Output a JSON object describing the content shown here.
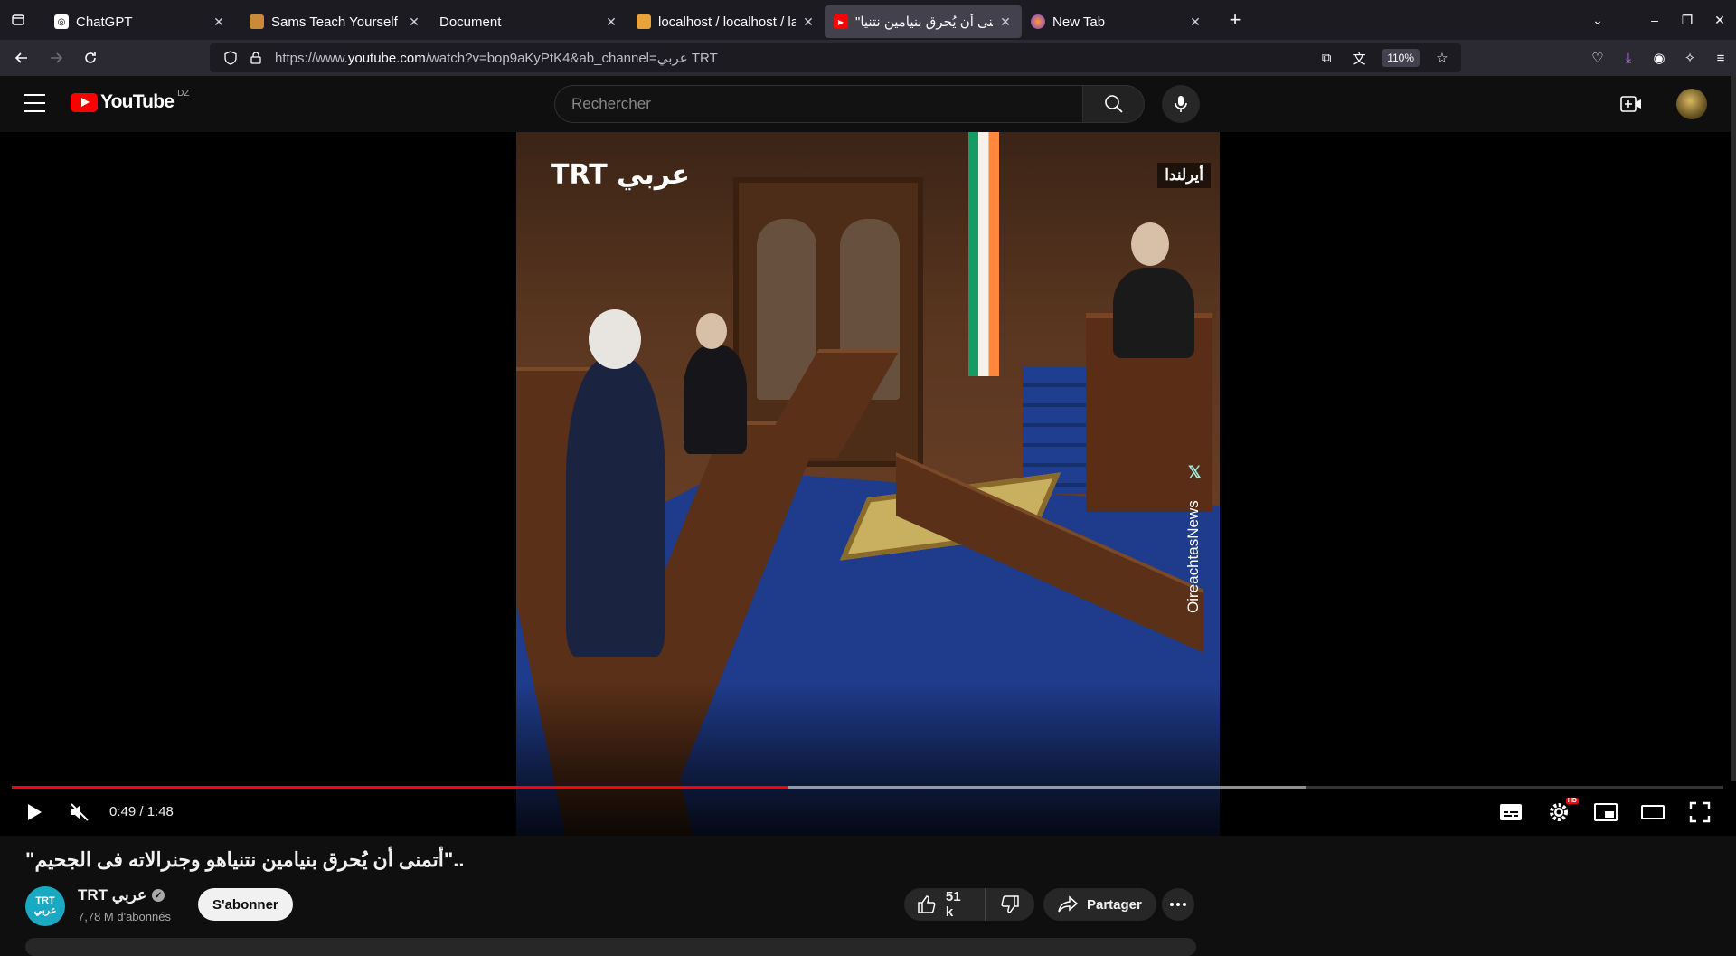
{
  "browser": {
    "tabs": [
      {
        "title": "ChatGPT",
        "active": false
      },
      {
        "title": "Sams Teach Yourself UML",
        "active": false
      },
      {
        "title": "Document",
        "active": false
      },
      {
        "title": "localhost / localhost / lara",
        "active": false
      },
      {
        "title": "\"أتمنى أن يُحرق بنيامين نتنيا",
        "active": true
      },
      {
        "title": "New Tab",
        "active": false
      }
    ],
    "url_prefix": "https://www.",
    "url_domain": "youtube.com",
    "url_rest": "/watch?v=bop9aKyPtK4&ab_channel=عربي TRT",
    "zoom": "110%"
  },
  "youtube": {
    "logo_text": "YouTube",
    "country_code": "DZ",
    "search_placeholder": "Rechercher"
  },
  "video": {
    "overlay_logo": "TRT عربي",
    "overlay_country": "أيرلندا",
    "watermark": "OireachtasNews",
    "current_time": "0:49",
    "duration": "1:48",
    "time_display": "0:49 / 1:48",
    "progress_fraction": 0.4537,
    "buffered_fraction": 0.756
  },
  "info": {
    "title": "\"أتمنى أن يُحرق بنيامين نتنياهو وجنرالاته فى الجحيم\"..",
    "channel_name": "TRT عربي",
    "channel_avatar_text": "TRT\nعربي",
    "subscribers": "7,78 M d'abonnés",
    "subscribe_label": "S'abonner",
    "likes": "51 k",
    "share_label": "Partager"
  },
  "colors": {
    "accent_red": "#ff0000",
    "background": "#0f0f0f",
    "channel_teal": "#1aa9c3"
  }
}
